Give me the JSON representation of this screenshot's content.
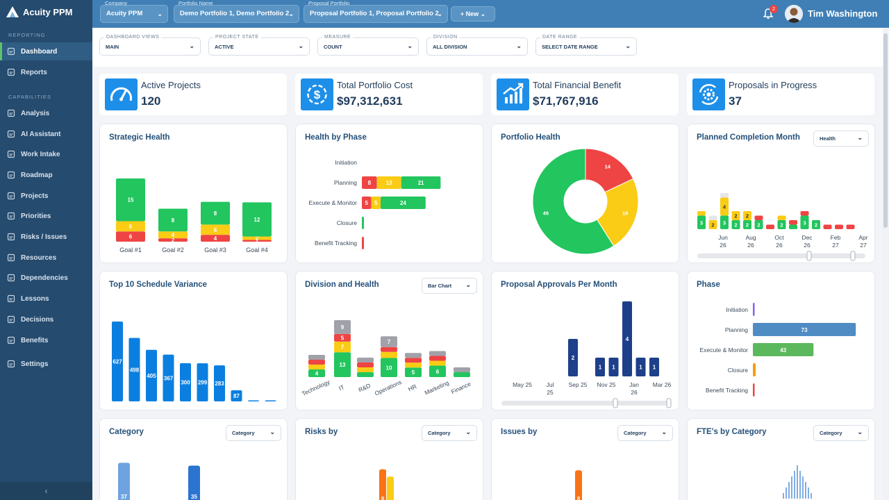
{
  "app": {
    "name": "Acuity PPM"
  },
  "sidebar": {
    "section_reporting": "REPORTING",
    "section_capabilities": "CAPABILITIES",
    "items": [
      {
        "label": "Dashboard",
        "icon": "home-icon"
      },
      {
        "label": "Reports",
        "icon": "report-icon"
      },
      {
        "label": "Analysis",
        "icon": "analysis-icon"
      },
      {
        "label": "AI Assistant",
        "icon": "robot-icon"
      },
      {
        "label": "Work Intake",
        "icon": "intake-icon"
      },
      {
        "label": "Roadmap",
        "icon": "roadmap-icon"
      },
      {
        "label": "Projects",
        "icon": "projects-icon"
      },
      {
        "label": "Priorities",
        "icon": "priorities-icon"
      },
      {
        "label": "Risks / Issues",
        "icon": "risks-icon"
      },
      {
        "label": "Resources",
        "icon": "resources-icon"
      },
      {
        "label": "Dependencies",
        "icon": "dependencies-icon"
      },
      {
        "label": "Lessons",
        "icon": "lessons-icon"
      },
      {
        "label": "Decisions",
        "icon": "decisions-icon"
      },
      {
        "label": "Benefits",
        "icon": "benefits-icon"
      },
      {
        "label": "Settings",
        "icon": "gear-icon"
      }
    ],
    "collapse": "‹"
  },
  "topbar": {
    "company": {
      "label": "Company",
      "value": "Acuity PPM"
    },
    "portfolio": {
      "label": "Portfolio Name",
      "value": "Demo Portfolio 1, Demo Portfolio 2"
    },
    "proposal": {
      "label": "Proposal Portfolio",
      "value": "Proposal Portfolio 1, Proposal Portfolio 2"
    },
    "new_label": "New",
    "notifications": "2",
    "user": "Tim Washington"
  },
  "filters": [
    {
      "label": "DASHBOARD VIEWS",
      "value": "MAIN"
    },
    {
      "label": "PROJECT STATE",
      "value": "ACTIVE"
    },
    {
      "label": "MEASURE",
      "value": "COUNT"
    },
    {
      "label": "DIVISION",
      "value": "ALL DIVISION"
    },
    {
      "label": "DATE RANGE",
      "value": "SELECT DATE RANGE"
    }
  ],
  "kpis": [
    {
      "title": "Active Projects",
      "value": "120",
      "icon": "gauge-icon"
    },
    {
      "title": "Total Portfolio Cost",
      "value": "$97,312,631",
      "icon": "dollar-icon"
    },
    {
      "title": "Total Financial Benefit",
      "value": "$71,767,916",
      "icon": "growth-chart-icon"
    },
    {
      "title": "Proposals in Progress",
      "value": "37",
      "icon": "gear-refresh-icon"
    }
  ],
  "colors": {
    "green": "#22c55e",
    "yellow": "#facc15",
    "red": "#ef4444",
    "gray": "#a1a1aa",
    "blue": "#0b7fe0",
    "navy": "#1e3f8a",
    "steel": "#4f8cc4",
    "orange": "#f97316"
  },
  "cards": {
    "strategic": {
      "title": "Strategic Health"
    },
    "health_phase": {
      "title": "Health by Phase"
    },
    "portfolio_health": {
      "title": "Portfolio Health"
    },
    "planned": {
      "title": "Planned Completion Month",
      "select": "Health"
    },
    "schedule": {
      "title": "Top 10 Schedule Variance"
    },
    "division": {
      "title": "Division and Health",
      "select": "Bar Chart"
    },
    "approvals": {
      "title": "Proposal Approvals Per Month"
    },
    "phase": {
      "title": "Phase"
    },
    "category": {
      "title": "Category",
      "select": "Category"
    },
    "risks": {
      "title": "Risks by",
      "select": "Category"
    },
    "issues": {
      "title": "Issues by",
      "select": "Category"
    },
    "fte": {
      "title": "FTE's by Category",
      "select": "Category"
    }
  },
  "chart_data": [
    {
      "id": "strategic",
      "type": "bar",
      "stacked": true,
      "categories": [
        "Goal #1",
        "Goal #2",
        "Goal #3",
        "Goal #4"
      ],
      "series": [
        {
          "color": "red",
          "values": [
            6,
            2,
            4,
            1
          ]
        },
        {
          "color": "yellow",
          "values": [
            6,
            4,
            6,
            2
          ]
        },
        {
          "color": "green",
          "values": [
            15,
            8,
            8,
            12
          ]
        }
      ]
    },
    {
      "id": "health_phase",
      "type": "bar",
      "orientation": "horizontal",
      "stacked": true,
      "categories": [
        "Initiation",
        "Planning",
        "Execute & Monitor",
        "Closure",
        "Benefit Tracking"
      ],
      "series": [
        {
          "color": "red",
          "values": [
            0,
            8,
            5,
            0,
            1
          ]
        },
        {
          "color": "yellow",
          "values": [
            0,
            13,
            5,
            0,
            0
          ]
        },
        {
          "color": "green",
          "values": [
            0,
            21,
            24,
            1,
            0
          ]
        }
      ]
    },
    {
      "id": "portfolio_health",
      "type": "pie",
      "donut": true,
      "slices": [
        {
          "color": "red",
          "value": 14
        },
        {
          "color": "yellow",
          "value": 18
        },
        {
          "color": "green",
          "value": 46
        }
      ]
    },
    {
      "id": "planned",
      "type": "bar",
      "stacked": true,
      "x_labels": [
        "Jun 26",
        "Aug 26",
        "Oct 26",
        "Dec 26",
        "Feb 27",
        "Apr 27"
      ],
      "values": [
        {
          "red": 0,
          "yellow": 1,
          "green": 3,
          "gray": 0
        },
        {
          "red": 0,
          "yellow": 2,
          "green": 0,
          "gray": 1
        },
        {
          "red": 0,
          "yellow": 4,
          "green": 3,
          "gray": 1
        },
        {
          "red": 0,
          "yellow": 2,
          "green": 2,
          "gray": 0
        },
        {
          "red": 0,
          "yellow": 2,
          "green": 2,
          "gray": 0
        },
        {
          "red": 1,
          "yellow": 0,
          "green": 2,
          "gray": 0
        },
        {
          "red": 1,
          "yellow": 0,
          "green": 0,
          "gray": 0
        },
        {
          "red": 0,
          "yellow": 1,
          "green": 2,
          "gray": 0
        },
        {
          "red": 1,
          "yellow": 0,
          "green": 1,
          "gray": 0
        },
        {
          "red": 1,
          "yellow": 0,
          "green": 3,
          "gray": 0
        },
        {
          "red": 0,
          "yellow": 0,
          "green": 2,
          "gray": 0
        },
        {
          "red": 1,
          "yellow": 0,
          "green": 0,
          "gray": 0
        },
        {
          "red": 1,
          "yellow": 0,
          "green": 0,
          "gray": 0
        },
        {
          "red": 1,
          "yellow": 0,
          "green": 0,
          "gray": 0
        }
      ]
    },
    {
      "id": "schedule",
      "type": "bar",
      "values": [
        627,
        498,
        405,
        367,
        300,
        299,
        283,
        87,
        6,
        2
      ]
    },
    {
      "id": "division",
      "type": "bar",
      "stacked": true,
      "categories": [
        "Technology",
        "IT",
        "R&D",
        "Operations",
        "HR",
        "Marketing",
        "Finance"
      ],
      "series": [
        {
          "color": "green",
          "values": [
            4,
            13,
            2,
            10,
            5,
            6,
            2
          ]
        },
        {
          "color": "yellow",
          "values": [
            2,
            7,
            1,
            4,
            1,
            3,
            0
          ]
        },
        {
          "color": "red",
          "values": [
            2,
            5,
            3,
            1,
            1,
            1,
            0
          ]
        },
        {
          "color": "gray",
          "values": [
            2,
            9,
            2,
            7,
            2,
            2,
            1
          ]
        }
      ]
    },
    {
      "id": "approvals",
      "type": "bar",
      "x_labels": [
        "May 25",
        "Jul 25",
        "Sep 25",
        "Nov 25",
        "Jan 26",
        "Mar 26"
      ],
      "values": [
        0,
        0,
        0,
        0,
        2,
        0,
        1,
        1,
        4,
        1,
        1
      ]
    },
    {
      "id": "phase",
      "type": "bar",
      "orientation": "horizontal",
      "categories": [
        "Initiation",
        "Planning",
        "Execute & Monitor",
        "Closure",
        "Benefit Tracking"
      ],
      "values": [
        1,
        73,
        43,
        2,
        1
      ],
      "colors": [
        "#8b5cf6",
        "#4f8cc4",
        "#5cb85c",
        "#f59e0b",
        "#ef4444"
      ]
    },
    {
      "id": "category",
      "type": "bar",
      "values": [
        37,
        35
      ],
      "colors": [
        "#6fa3e0",
        "#2b74d0"
      ]
    },
    {
      "id": "risks",
      "type": "bar",
      "values": [
        11,
        9,
        2
      ],
      "colors": [
        "#f97316",
        "#facc15",
        "#f97316"
      ]
    },
    {
      "id": "issues",
      "type": "bar",
      "values": [
        9,
        1
      ],
      "colors": [
        "#f97316",
        "#facc15"
      ]
    },
    {
      "id": "fte",
      "type": "bar",
      "values": [
        1,
        2,
        3,
        4,
        5,
        6,
        5,
        4,
        3,
        2,
        1
      ]
    }
  ]
}
